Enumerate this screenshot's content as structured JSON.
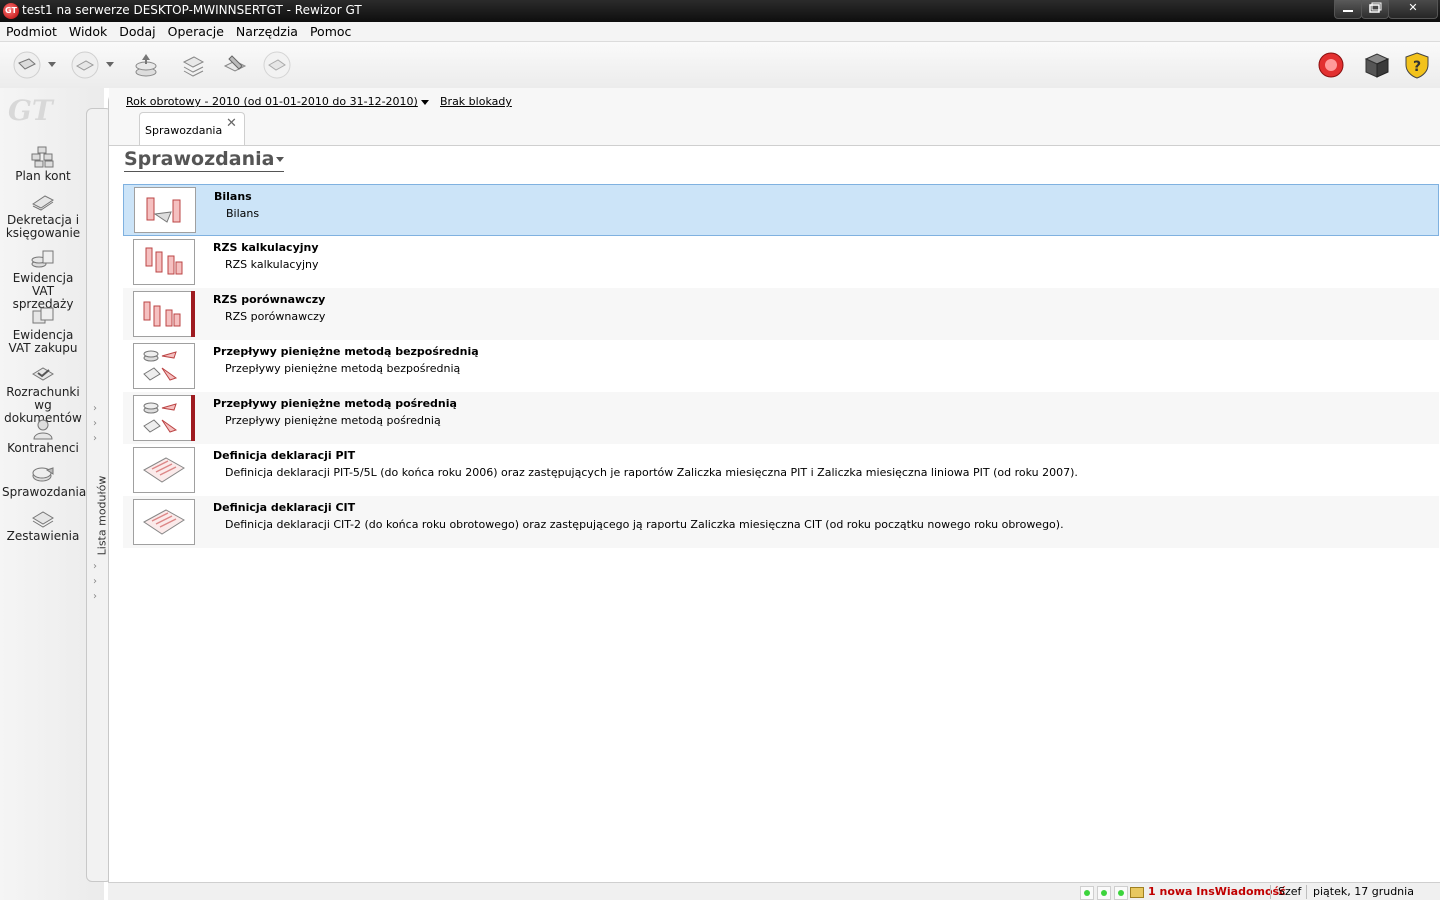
{
  "window": {
    "title": "test1 na serwerze DESKTOP-MWINNSERTGT - Rewizor GT",
    "app_icon": "GT",
    "close_glyph": "✕"
  },
  "menu": [
    "Podmiot",
    "Widok",
    "Dodaj",
    "Operacje",
    "Narzędzia",
    "Pomoc"
  ],
  "toolbar": {
    "left_icons": [
      "open-subject-icon",
      "save-icon",
      "upload-icon",
      "stack-icon",
      "edit-icon",
      "document-icon"
    ],
    "right_icons": [
      "alert-icon",
      "box-icon",
      "help-icon"
    ],
    "help_glyph": "?"
  },
  "sidebar": {
    "logo": "GT",
    "strip_label": "Lista modułów",
    "chevron_glyph": "›",
    "modules": [
      {
        "label": "Plan kont",
        "icon": "accounts-plan-icon"
      },
      {
        "label": "Dekretacja i księgowanie",
        "icon": "posting-icon"
      },
      {
        "label": "Ewidencja VAT sprzedaży",
        "icon": "vat-sales-icon"
      },
      {
        "label": "Ewidencja VAT zakupu",
        "icon": "vat-purchase-icon"
      },
      {
        "label": "Rozrachunki wg dokumentów",
        "icon": "settlements-icon"
      },
      {
        "label": "Kontrahenci",
        "icon": "contractors-icon"
      },
      {
        "label": "Sprawozdania",
        "icon": "reports-icon"
      },
      {
        "label": "Zestawienia",
        "icon": "summaries-icon"
      }
    ]
  },
  "infobar": {
    "fiscal_year": "Rok obrotowy - 2010  (od 01-01-2010 do 31-12-2010)",
    "lock_status": "Brak blokady"
  },
  "tab": {
    "label": "Sprawozdania",
    "close": "✕"
  },
  "page_title": "Sprawozdania",
  "reports": [
    {
      "title": "Bilans",
      "desc": "Bilans",
      "icon": "balance-chart-icon",
      "selected": true,
      "marker": false
    },
    {
      "title": "RZS kalkulacyjny",
      "desc": "RZS kalkulacyjny",
      "icon": "pl-calc-chart-icon",
      "selected": false,
      "marker": false
    },
    {
      "title": "RZS porównawczy",
      "desc": "RZS porównawczy",
      "icon": "pl-compare-chart-icon",
      "selected": false,
      "marker": true
    },
    {
      "title": "Przepływy pieniężne metodą bezpośrednią",
      "desc": "Przepływy pieniężne metodą bezpośrednią",
      "icon": "cashflow-direct-icon",
      "selected": false,
      "marker": false
    },
    {
      "title": "Przepływy pieniężne metodą pośrednią",
      "desc": "Przepływy pieniężne metodą pośrednią",
      "icon": "cashflow-indirect-icon",
      "selected": false,
      "marker": true
    },
    {
      "title": "Definicja deklaracji PIT",
      "desc": "Definicja deklaracji PIT-5/5L (do końca roku 2006) oraz zastępujących je raportów Zaliczka miesięczna PIT i Zaliczka miesięczna liniowa PIT (od roku 2007).",
      "icon": "pit-form-icon",
      "selected": false,
      "marker": false
    },
    {
      "title": "Definicja deklaracji CIT",
      "desc": "Definicja deklaracji CIT-2 (do końca roku obrotowego) oraz zastępującego ją raportu Zaliczka miesięczna CIT (od roku początku nowego roku obrowego).",
      "icon": "cit-form-icon",
      "selected": false,
      "marker": false
    }
  ],
  "status": {
    "message": "1 nowa InsWiadomość",
    "user": "Szef",
    "date": "piątek, 17 grudnia 2010"
  },
  "colors": {
    "selection": "#cce4f8",
    "marker_red": "#9e1b20",
    "status_message": "#c00000"
  }
}
